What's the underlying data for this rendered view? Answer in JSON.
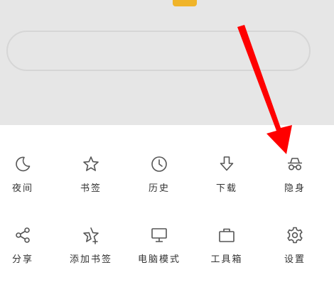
{
  "colors": {
    "background_top": "#e6e6e6",
    "panel": "#ffffff",
    "icon_stroke": "#555555",
    "label": "#333333",
    "accent_logo": "#f0b429",
    "annotation_arrow": "#ff0000"
  },
  "menu": {
    "row1": [
      {
        "label": "夜间",
        "icon": "moon-icon"
      },
      {
        "label": "书签",
        "icon": "star-icon"
      },
      {
        "label": "历史",
        "icon": "clock-icon"
      },
      {
        "label": "下载",
        "icon": "download-icon"
      },
      {
        "label": "隐身",
        "icon": "incognito-icon"
      }
    ],
    "row2": [
      {
        "label": "分享",
        "icon": "share-icon"
      },
      {
        "label": "添加书签",
        "icon": "star-plus-icon"
      },
      {
        "label": "电脑模式",
        "icon": "monitor-icon"
      },
      {
        "label": "工具箱",
        "icon": "toolbox-icon"
      },
      {
        "label": "设置",
        "icon": "gear-icon"
      }
    ]
  }
}
